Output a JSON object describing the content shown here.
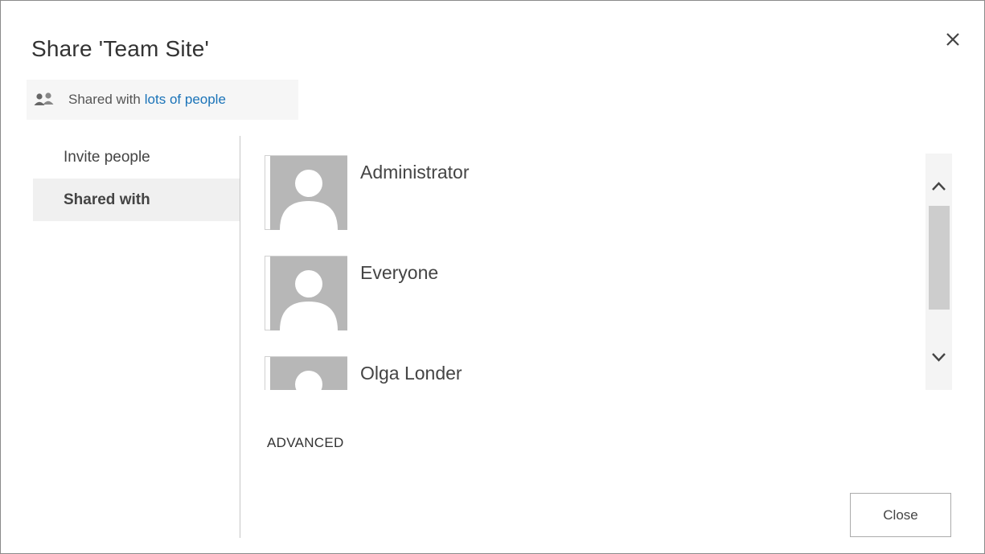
{
  "dialog": {
    "title": "Share 'Team Site'",
    "close_icon": "close-icon"
  },
  "shared_bar": {
    "icon": "people-icon",
    "text": "Shared with",
    "link": "lots of people",
    "link_color": "#1a73b8"
  },
  "nav": {
    "items": [
      {
        "label": "Invite people",
        "selected": false
      },
      {
        "label": "Shared with",
        "selected": true
      }
    ]
  },
  "people": [
    {
      "name": "Administrator",
      "avatar": "default-avatar-icon"
    },
    {
      "name": "Everyone",
      "avatar": "default-avatar-icon"
    },
    {
      "name": "Olga Londer",
      "avatar": "default-avatar-icon"
    }
  ],
  "scrollbar": {
    "up_icon": "chevron-up-icon",
    "down_icon": "chevron-down-icon"
  },
  "advanced_label": "ADVANCED",
  "footer": {
    "close_label": "Close"
  }
}
